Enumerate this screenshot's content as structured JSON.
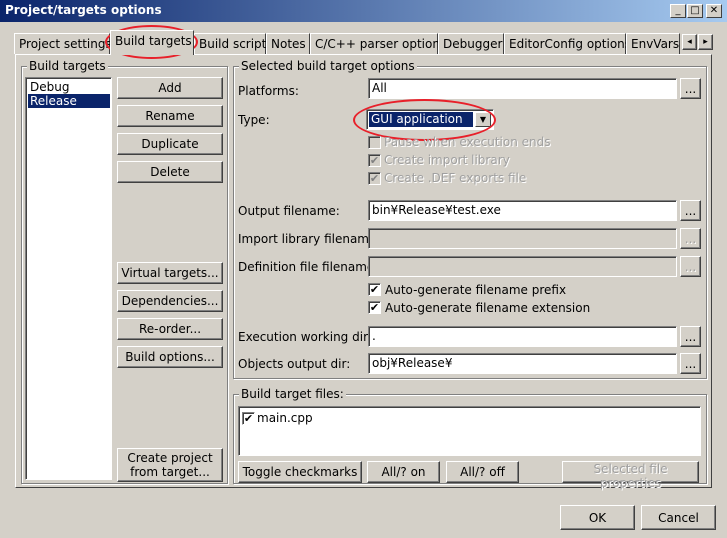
{
  "window": {
    "title": "Project/targets options",
    "controls": [
      "_",
      "□",
      "✕"
    ]
  },
  "tabs": [
    "Project settings",
    "Build targets",
    "Build scripts",
    "Notes",
    "C/C++ parser options",
    "Debugger",
    "EditorConfig options",
    "EnvVars"
  ],
  "tab_scroll": {
    "left": "◂",
    "right": "▸"
  },
  "build_targets": {
    "group_title": "Build targets",
    "items": [
      "Debug",
      "Release"
    ],
    "selected": "Release",
    "buttons": {
      "add": "Add",
      "rename": "Rename",
      "duplicate": "Duplicate",
      "delete": "Delete",
      "virtual_targets": "Virtual targets...",
      "dependencies": "Dependencies...",
      "reorder": "Re-order...",
      "build_options": "Build options...",
      "create_project_line1": "Create project",
      "create_project_line2": "from target..."
    }
  },
  "options": {
    "group_title": "Selected build target options",
    "platforms_label": "Platforms:",
    "platforms_value": "All",
    "type_label": "Type:",
    "type_value": "GUI application",
    "pause_label": "Pause when execution ends",
    "import_lib_label": "Create import library",
    "def_exports_label": "Create .DEF exports file",
    "output_label": "Output filename:",
    "output_value": "bin¥Release¥test.exe",
    "import_filename_label": "Import library filename:",
    "def_filename_label": "Definition file filename:",
    "auto_prefix_label": "Auto-generate filename prefix",
    "auto_ext_label": "Auto-generate filename extension",
    "working_dir_label": "Execution working dir:",
    "working_dir_value": ".",
    "objects_dir_label": "Objects output dir:",
    "objects_dir_value": "obj¥Release¥",
    "browse": "...",
    "check_mark": "✔"
  },
  "files": {
    "group_title": "Build target files:",
    "items": [
      "main.cpp"
    ],
    "buttons": {
      "toggle": "Toggle checkmarks",
      "all_on": "All/? on",
      "all_off": "All/? off",
      "props": "Selected file properties"
    }
  },
  "footer": {
    "ok": "OK",
    "cancel": "Cancel"
  },
  "colors": {
    "highlight": "#0a246a",
    "annotation": "#e8202a",
    "face": "#d4d0c8"
  }
}
